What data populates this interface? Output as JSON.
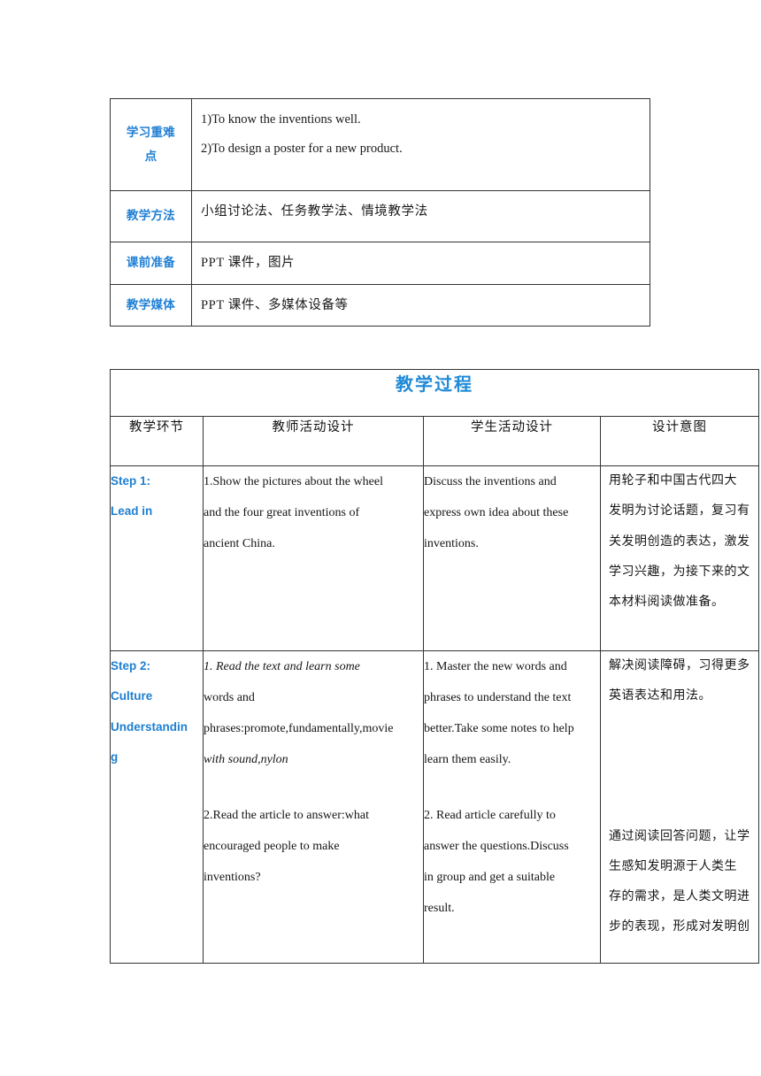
{
  "basic_table": {
    "rows": [
      {
        "label": "学习重难\n点",
        "label_line1": "学习重难",
        "label_line2": "点",
        "value_lines": [
          "1)To know the inventions well.",
          "2)To design a poster for a new product."
        ]
      },
      {
        "label_line1": "教学方法",
        "label_line2": "",
        "value_lines": [
          "小组讨论法、任务教学法、情境教学法"
        ]
      },
      {
        "label_line1": "课前准备",
        "label_line2": "",
        "value_lines": [
          "PPT 课件，图片"
        ]
      },
      {
        "label_line1": "教学媒体",
        "label_line2": "",
        "value_lines": [
          "PPT 课件、多媒体设备等"
        ]
      }
    ]
  },
  "process_table": {
    "title": "教学过程",
    "headers": [
      "教学环节",
      "教师活动设计",
      "学生活动设计",
      "设计意图"
    ],
    "rows": [
      {
        "step_lines": [
          "Step 1:",
          "Lead in"
        ],
        "teacher_lines": [
          "1.Show the pictures about the wheel",
          "and the four great inventions of",
          "ancient China."
        ],
        "student_lines": [
          "Discuss the inventions and",
          "express own idea about these",
          "inventions."
        ],
        "aim_lines": [
          "用轮子和中国古代四大",
          "发明为讨论话题，复习有",
          "关发明创造的表达，激发",
          "学习兴趣，为接下来的文",
          "本材料阅读做准备。"
        ]
      },
      {
        "step_lines": [
          "Step 2:",
          "Culture",
          "Understandin",
          "g"
        ],
        "teacher_part1_lines": [
          "1.   Read the text and learn some",
          "words and",
          "phrases:promote,fundamentally,movie",
          "with sound,nylon"
        ],
        "teacher_part1_italic_prefix": "1.",
        "teacher_part1_italic_tail": "promote,fundamentally,movie with sound,nylon",
        "teacher_part2_lines": [
          "2.Read the article to answer:what",
          "encouraged people to make",
          "inventions?"
        ],
        "student_part1_lines": [
          "1.   Master the new words and",
          "phrases to understand the text",
          "better.Take some notes to help",
          "learn them easily."
        ],
        "student_part2_lines": [
          "2.   Read article carefully to",
          "answer the questions.Discuss",
          "in group and get a suitable",
          "result."
        ],
        "aim_part1_lines": [
          "解决阅读障碍，习得更多",
          "英语表达和用法。"
        ],
        "aim_part2_lines": [
          "通过阅读回答问题，让学",
          "生感知发明源于人类生",
          "存的需求，是人类文明进",
          "步的表现，形成对发明创"
        ]
      }
    ]
  },
  "colors": {
    "accent_blue": "#1F7FD4",
    "title_blue": "#1F8AD8",
    "border": "#333333",
    "text": "#151515"
  }
}
